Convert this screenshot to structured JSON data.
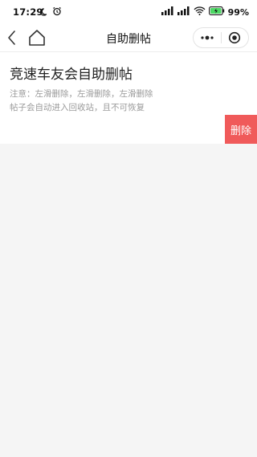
{
  "status_bar": {
    "time": "17:29",
    "battery": "99%"
  },
  "nav": {
    "title": "自助删帖"
  },
  "page": {
    "heading": "竞速车友会自助删帖",
    "note_line1": "注意：左滑删除，左滑删除，左滑删除",
    "note_line2": "帖子会自动进入回收站，且不可恢复"
  },
  "list": {
    "items": [
      {
        "title": "",
        "delete_label": "删除"
      }
    ]
  },
  "colors": {
    "delete_bg": "#f05a5a",
    "background": "#f5f5f5"
  },
  "icons": [
    "moon-icon",
    "alarm-icon",
    "signal-icon",
    "wifi-icon",
    "battery-icon",
    "back-icon",
    "home-icon",
    "more-icon",
    "close-mini-icon"
  ]
}
